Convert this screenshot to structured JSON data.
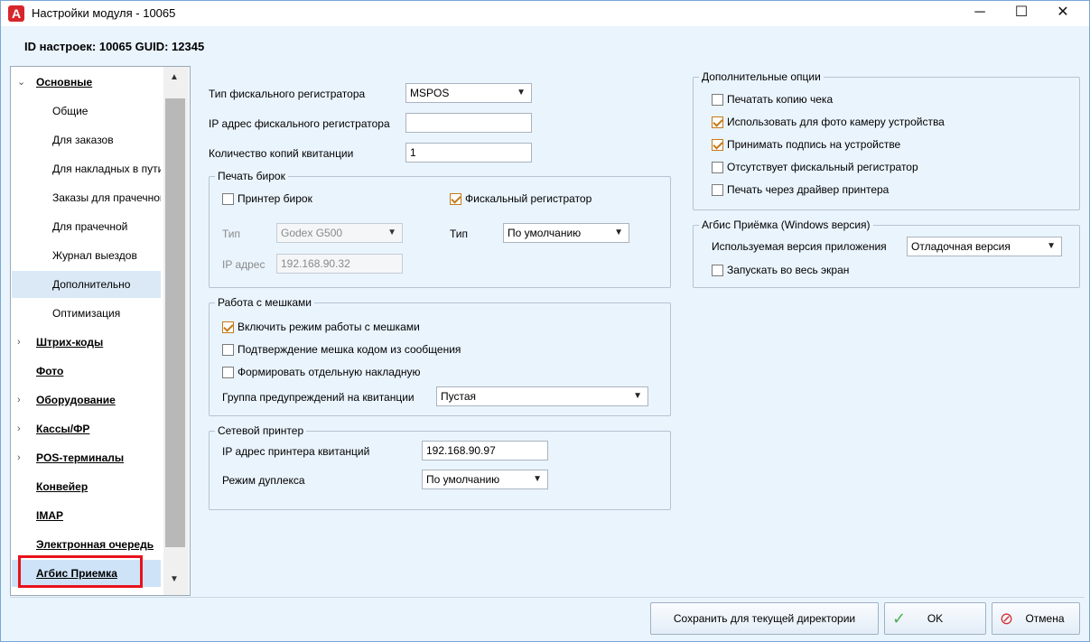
{
  "window": {
    "title": "Настройки модуля  - 10065",
    "app_icon": "A",
    "min_glyph": "─",
    "max_glyph": "☐",
    "close_glyph": "✕"
  },
  "info": {
    "text": "ID настроек: 10065   GUID: 12345"
  },
  "nav": {
    "items": [
      {
        "label": "Основные",
        "type": "top",
        "chevron": "⌄"
      },
      {
        "label": "Общие",
        "type": "sub"
      },
      {
        "label": "Для заказов",
        "type": "sub"
      },
      {
        "label": "Для накладных в пути",
        "type": "sub"
      },
      {
        "label": "Заказы для прачечной",
        "type": "sub"
      },
      {
        "label": "Для прачечной",
        "type": "sub"
      },
      {
        "label": "Журнал выездов",
        "type": "sub"
      },
      {
        "label": "Дополнительно",
        "type": "sub"
      },
      {
        "label": "Оптимизация",
        "type": "sub"
      },
      {
        "label": "Штрих-коды",
        "type": "top",
        "chevron": "›"
      },
      {
        "label": "Фото",
        "type": "top"
      },
      {
        "label": "Оборудование",
        "type": "top",
        "chevron": "›"
      },
      {
        "label": "Кассы/ФР",
        "type": "top",
        "chevron": "›"
      },
      {
        "label": "POS-терминалы",
        "type": "top",
        "chevron": "›"
      },
      {
        "label": "Конвейер",
        "type": "top"
      },
      {
        "label": "IMAP",
        "type": "top"
      },
      {
        "label": "Электронная очередь",
        "type": "top"
      },
      {
        "label": "Агбис Приемка",
        "type": "top"
      }
    ],
    "scroll_up": "▲",
    "scroll_down": "▼"
  },
  "main": {
    "fiscal_type_label": "Тип фискального регистратора",
    "fiscal_type_value": "MSPOS",
    "fiscal_ip_label": "IP адрес фискального регистратора",
    "fiscal_ip_value": "",
    "copies_label": "Количество копий квитанции",
    "copies_value": "1",
    "tags_group": {
      "title": "Печать бирок",
      "tag_printer_label": "Принтер бирок",
      "tag_printer_checked": false,
      "fiscal_label": "Фискальный регистратор",
      "fiscal_checked": true,
      "type_label": "Тип",
      "type_value": "Godex G500",
      "ip_label": "IP адрес",
      "ip_value": "192.168.90.32",
      "type2_label": "Тип",
      "type2_value": "По умолчанию"
    },
    "bags_group": {
      "title": "Работа с мешками",
      "enable_label": "Включить режим работы с мешками",
      "enable_checked": true,
      "confirm_label": "Подтверждение мешка кодом из сообщения",
      "confirm_checked": false,
      "separate_label": "Формировать отдельную накладную",
      "separate_checked": false,
      "warn_group_label": "Группа предупреждений на квитанции",
      "warn_group_value": "Пустая"
    },
    "net_printer_group": {
      "title": "Сетевой принтер",
      "ip_label": "IP адрес принтера квитанций",
      "ip_value": "192.168.90.97",
      "duplex_label": "Режим дуплекса",
      "duplex_value": "По умолчанию"
    },
    "extra_options": {
      "title": "Дополнительные опции",
      "items": [
        {
          "label": "Печатать копию чека",
          "checked": false
        },
        {
          "label": "Использовать для фото камеру устройства",
          "checked": true
        },
        {
          "label": "Принимать подпись на устройстве",
          "checked": true
        },
        {
          "label": "Отсутствует фискальный регистратор",
          "checked": false
        },
        {
          "label": "Печать через драйвер принтера",
          "checked": false
        }
      ]
    },
    "agbis_group": {
      "title": "Агбис Приёмка (Windows версия)",
      "version_label": "Используемая версия приложения",
      "version_value": "Отладочная версия",
      "fullscreen_label": "Запускать во весь экран",
      "fullscreen_checked": false
    },
    "dropdown_arrow": "▼"
  },
  "footer": {
    "save_dir_label": "Сохранить для текущей директории",
    "ok_label": "OK",
    "cancel_label": "Отмена",
    "ok_icon": "✓",
    "cancel_icon": "⊘",
    "ok_color": "#4caf50",
    "cancel_color": "#d32f2f"
  }
}
